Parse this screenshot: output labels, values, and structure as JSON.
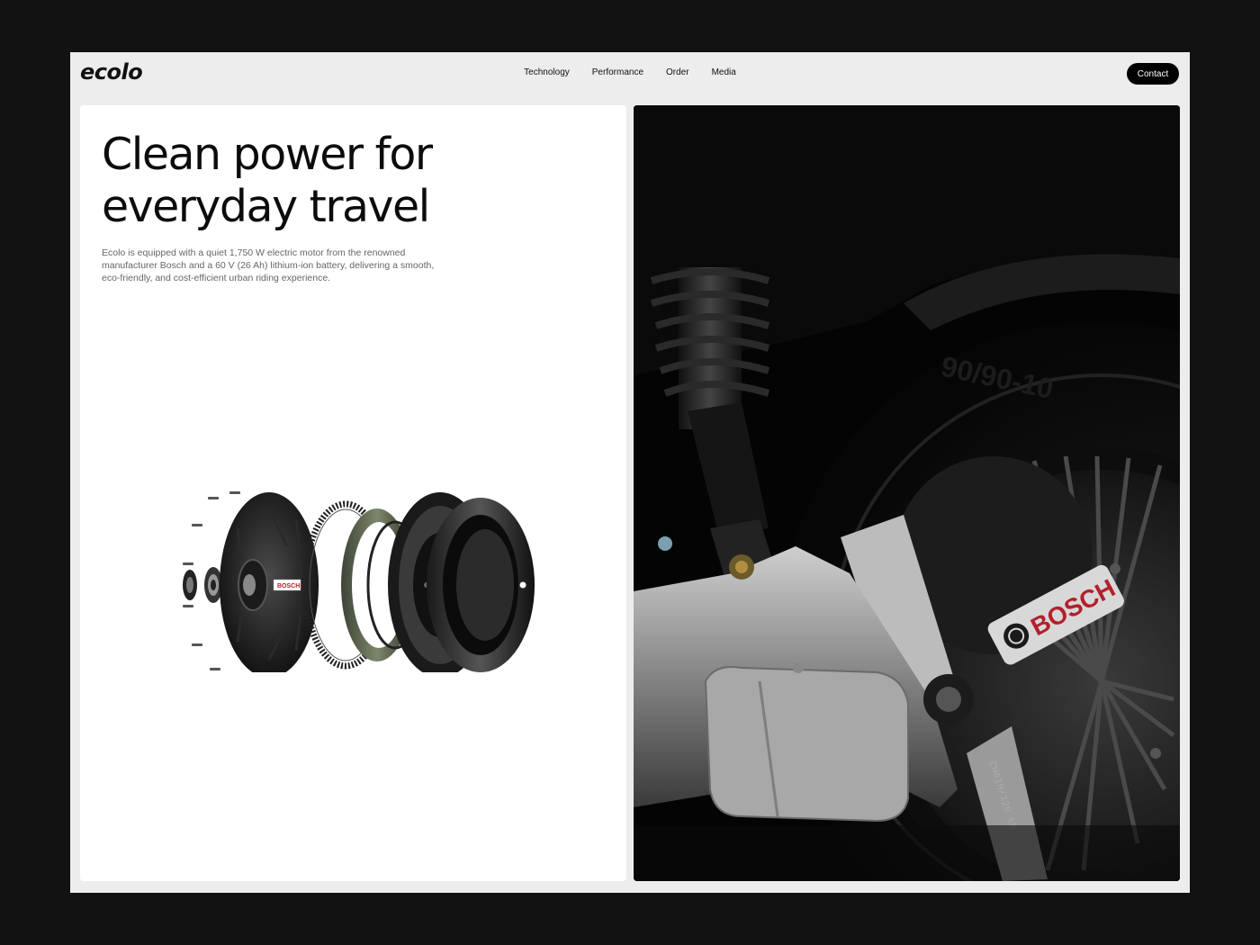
{
  "brand": {
    "logo": "ecolo"
  },
  "nav": {
    "items": [
      {
        "label": "Technology"
      },
      {
        "label": "Performance"
      },
      {
        "label": "Order"
      },
      {
        "label": "Media"
      }
    ],
    "contact_label": "Contact"
  },
  "hero": {
    "headline_line1": "Clean power for",
    "headline_line2": "everyday travel",
    "description": "Ecolo is equipped with a quiet 1,750 W electric motor from the renowned manufacturer Bosch and a 60 V (26 Ah) lithium-ion battery, delivering a smooth, eco-friendly, and cost-efficient urban riding experience."
  },
  "images": {
    "exploded_motor": {
      "brand_label": "BOSCH"
    },
    "wheel_photo": {
      "brand_label": "BOSCH",
      "tire_marking": "90/90-10",
      "axle_marking": "CH6I0/120 kM"
    }
  },
  "colors": {
    "page_background": "#121212",
    "frame_background": "#ededed",
    "panel_background": "#ffffff",
    "accent_black": "#000000",
    "bosch_red": "#b3202a"
  }
}
